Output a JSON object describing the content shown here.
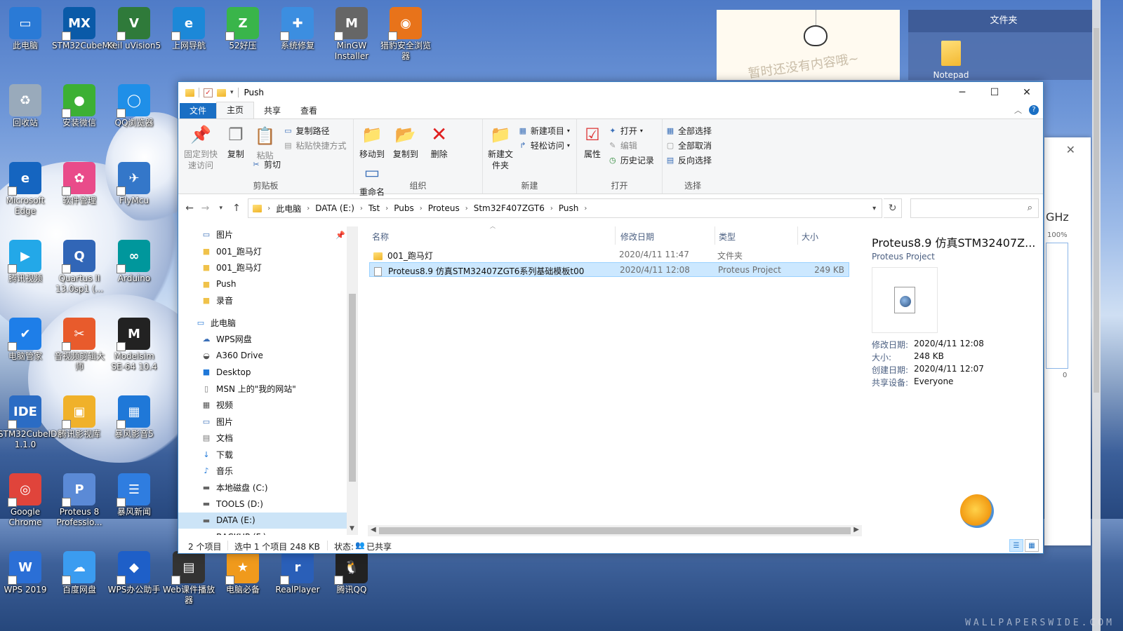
{
  "desktop": {
    "icons": [
      {
        "label": "此电脑",
        "icon": "computer-icon",
        "color": "#2a7ad6"
      },
      {
        "label": "STM32CubeMX",
        "icon": "stm32cubemx-icon",
        "color": "#0a5aa8"
      },
      {
        "label": "Keil uVision5",
        "icon": "keil-icon",
        "color": "#2f7a3a"
      },
      {
        "label": "上网导航",
        "icon": "ie-icon",
        "color": "#1c88d8"
      },
      {
        "label": "52好压",
        "icon": "zip-icon",
        "color": "#39b54a"
      },
      {
        "label": "系统修复",
        "icon": "doctor-icon",
        "color": "#3c8ee0"
      },
      {
        "label": "MinGW Installer",
        "icon": "mingw-icon",
        "color": "#666666"
      },
      {
        "label": "猎豹安全浏览器",
        "icon": "liebao-browser-icon",
        "color": "#e8731a"
      },
      {
        "label": "回收站",
        "icon": "recycle-bin-icon",
        "color": "#9ab"
      },
      {
        "label": "安装微信",
        "icon": "wechat-icon",
        "color": "#3cb034"
      },
      {
        "label": "QQ浏览器",
        "icon": "qq-browser-icon",
        "color": "#1f8fe8"
      },
      {
        "label": "Microsoft Edge",
        "icon": "edge-icon",
        "color": "#1565c0"
      },
      {
        "label": "软件管理",
        "icon": "software-manager-icon",
        "color": "#e94b8a"
      },
      {
        "label": "FlyMcu",
        "icon": "flymcu-icon",
        "color": "#3477c9"
      },
      {
        "label": "腾讯视频",
        "icon": "tencent-video-icon",
        "color": "#23a8e8"
      },
      {
        "label": "Quartus II 13.0sp1 (...",
        "icon": "quartus-icon",
        "color": "#3166b7"
      },
      {
        "label": "Arduino",
        "icon": "arduino-icon",
        "color": "#00979c"
      },
      {
        "label": "电脑管家",
        "icon": "pc-manager-icon",
        "color": "#1e7ee8"
      },
      {
        "label": "音视频剪辑大师",
        "icon": "video-editor-icon",
        "color": "#e85b2c"
      },
      {
        "label": "Modelsim SE-64 10.4",
        "icon": "modelsim-icon",
        "color": "#222222"
      },
      {
        "label": "STM32CubeIDE 1.1.0",
        "icon": "stm32cubeide-icon",
        "color": "#2b6cc4"
      },
      {
        "label": "腾讯影视库",
        "icon": "tencent-film-icon",
        "color": "#f0b12a"
      },
      {
        "label": "暴风影音5",
        "icon": "baofeng-icon",
        "color": "#1f78d8"
      },
      {
        "label": "Google Chrome",
        "icon": "chrome-icon",
        "color": "#e0443b"
      },
      {
        "label": "Proteus 8 Professio...",
        "icon": "proteus-icon",
        "color": "#5b8ad6"
      },
      {
        "label": "暴风新闻",
        "icon": "baofeng-news-icon",
        "color": "#2f7de0"
      },
      {
        "label": "WPS 2019",
        "icon": "wps-icon",
        "color": "#2b6fd6"
      },
      {
        "label": "百度网盘",
        "icon": "baidu-netdisk-icon",
        "color": "#3b9cf0"
      },
      {
        "label": "WPS办公助手",
        "icon": "wps-assistant-icon",
        "color": "#1e5fc8"
      },
      {
        "label": "Web课件播放器",
        "icon": "web-courseware-icon",
        "color": "#333333"
      },
      {
        "label": "电脑必备",
        "icon": "pc-essentials-icon",
        "color": "#f09a1c"
      },
      {
        "label": "RealPlayer",
        "icon": "realplayer-icon",
        "color": "#2a5fb8"
      },
      {
        "label": "腾讯QQ",
        "icon": "qq-icon",
        "color": "#222222"
      }
    ],
    "note_widget_text": "暂时还没有内容哦~",
    "folder_widget": {
      "title": "文件夹",
      "item_label": "Notepad"
    },
    "bg_window": {
      "freq_unit": "GHz",
      "percent": "100%",
      "zero": "0"
    },
    "watermark": "WALLPAPERSWIDE.COM"
  },
  "window": {
    "title": "Push",
    "controls": {
      "minimize": "─",
      "maximize": "☐",
      "close": "✕"
    },
    "tabs": {
      "file": "文件",
      "home": "主页",
      "share": "共享",
      "view": "查看"
    },
    "ribbon": {
      "clipboard": {
        "label": "剪贴板",
        "pin": "固定到快速访问",
        "copy": "复制",
        "paste": "粘贴",
        "copy_path": "复制路径",
        "paste_shortcut": "粘贴快捷方式",
        "cut": "剪切"
      },
      "organize": {
        "label": "组织",
        "move_to": "移动到",
        "copy_to": "复制到",
        "delete": "删除",
        "rename": "重命名"
      },
      "new": {
        "label": "新建",
        "new_folder": "新建文件夹",
        "new_item": "新建项目",
        "easy_access": "轻松访问"
      },
      "open": {
        "label": "打开",
        "properties": "属性",
        "open": "打开",
        "edit": "编辑",
        "history": "历史记录"
      },
      "select": {
        "label": "选择",
        "select_all": "全部选择",
        "select_none": "全部取消",
        "invert": "反向选择"
      }
    },
    "address": {
      "crumbs": [
        "此电脑",
        "DATA (E:)",
        "Tst",
        "Pubs",
        "Proteus",
        "Stm32F407ZGT6",
        "Push"
      ],
      "search_placeholder": ""
    },
    "nav": [
      {
        "label": "图片",
        "icon": "pictures-icon",
        "indent": 1
      },
      {
        "label": "001_跑马灯",
        "icon": "folder-icon",
        "indent": 1
      },
      {
        "label": "001_跑马灯",
        "icon": "folder-icon",
        "indent": 1
      },
      {
        "label": "Push",
        "icon": "folder-icon",
        "indent": 1
      },
      {
        "label": "录音",
        "icon": "folder-icon",
        "indent": 1
      },
      {
        "label": "此电脑",
        "icon": "computer-icon",
        "indent": 0
      },
      {
        "label": "WPS网盘",
        "icon": "cloud-icon",
        "indent": 1
      },
      {
        "label": "A360 Drive",
        "icon": "a360-icon",
        "indent": 1
      },
      {
        "label": "Desktop",
        "icon": "desktop-icon",
        "indent": 1
      },
      {
        "label": "MSN 上的\"我的网站\"",
        "icon": "document-icon",
        "indent": 1
      },
      {
        "label": "视频",
        "icon": "video-icon",
        "indent": 1
      },
      {
        "label": "图片",
        "icon": "pictures-icon",
        "indent": 1
      },
      {
        "label": "文档",
        "icon": "documents-icon",
        "indent": 1
      },
      {
        "label": "下载",
        "icon": "download-icon",
        "indent": 1
      },
      {
        "label": "音乐",
        "icon": "music-icon",
        "indent": 1
      },
      {
        "label": "本地磁盘 (C:)",
        "icon": "drive-icon",
        "indent": 1
      },
      {
        "label": "TOOLS (D:)",
        "icon": "drive-icon",
        "indent": 1
      },
      {
        "label": "DATA (E:)",
        "icon": "drive-icon",
        "indent": 1,
        "selected": true
      },
      {
        "label": "BACKUP (F:)",
        "icon": "drive-icon",
        "indent": 1
      }
    ],
    "columns": {
      "name": "名称",
      "modified": "修改日期",
      "type": "类型",
      "size": "大小"
    },
    "files": [
      {
        "name": "001_跑马灯",
        "modified": "2020/4/11 11:47",
        "type": "文件夹",
        "size": "",
        "icon": "folder-icon"
      },
      {
        "name": "Proteus8.9 仿真STM32407ZGT6系列基础模板t00",
        "modified": "2020/4/11 12:08",
        "type": "Proteus Project",
        "size": "249 KB",
        "icon": "proteus-file-icon",
        "selected": true
      }
    ],
    "preview": {
      "title": "Proteus8.9 仿真STM32407Z...",
      "type": "Proteus Project",
      "props": [
        {
          "k": "修改日期:",
          "v": "2020/4/11 12:08"
        },
        {
          "k": "大小:",
          "v": "248 KB"
        },
        {
          "k": "创建日期:",
          "v": "2020/4/11 12:07"
        },
        {
          "k": "共享设备:",
          "v": "Everyone"
        }
      ]
    },
    "status": {
      "count": "2 个项目",
      "selected": "选中 1 个项目  248 KB",
      "state_label": "状态:",
      "state_value": "已共享"
    }
  }
}
